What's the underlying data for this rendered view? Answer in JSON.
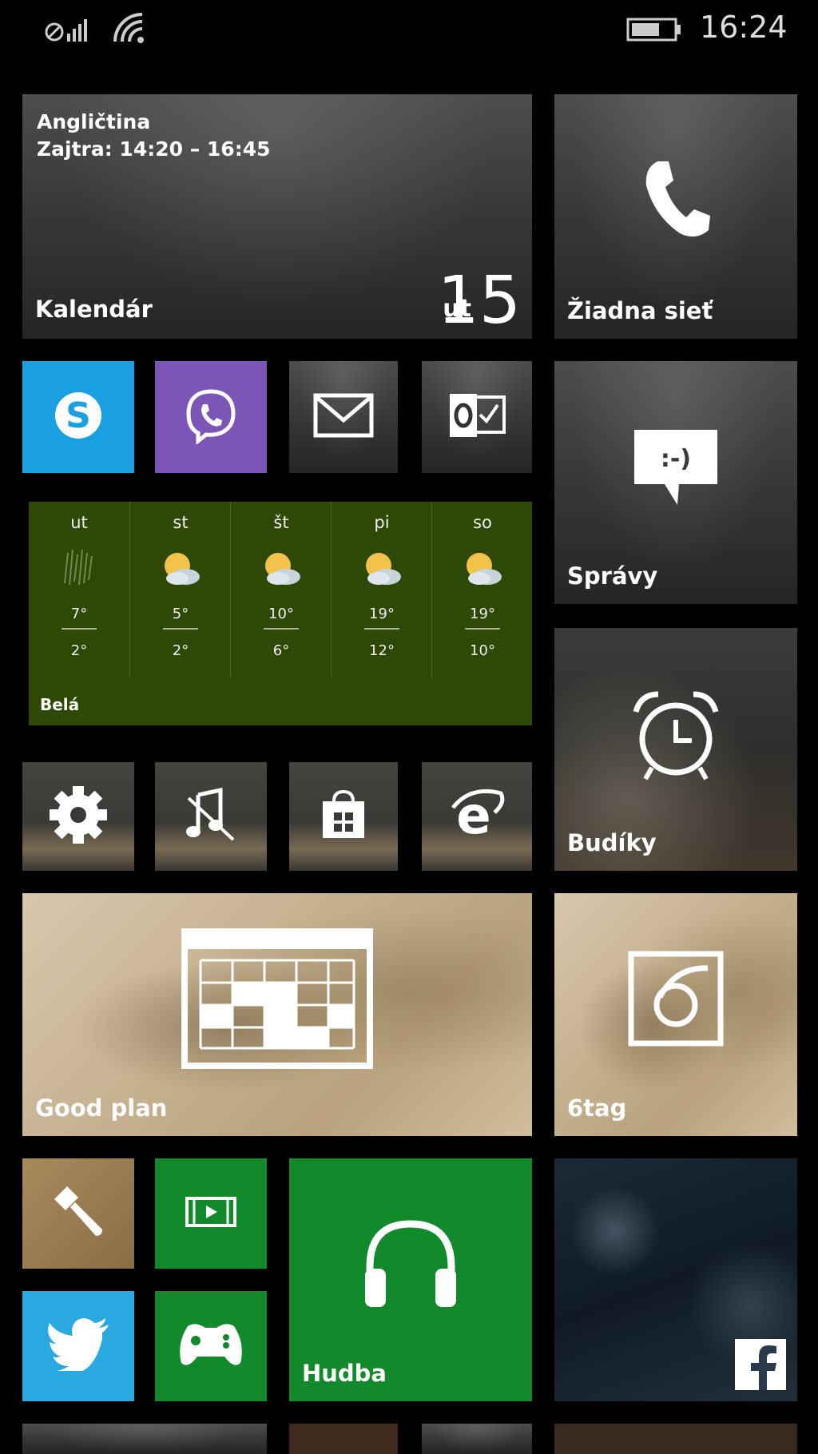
{
  "status_bar": {
    "time": "16:24"
  },
  "calendar_tile": {
    "event_title": "Angličtina",
    "event_time": "Zajtra: 14:20 – 16:45",
    "label": "Kalendár",
    "day_name": "ut",
    "day_number": "15"
  },
  "phone_tile": {
    "label": "Žiadna sieť",
    "icon": "phone-icon"
  },
  "messages_tile": {
    "label": "Správy",
    "icon": "message-icon"
  },
  "weather_tile": {
    "location": "Belá",
    "days": [
      {
        "day": "ut",
        "high": "7°",
        "low": "2°",
        "icon": "rain-icon"
      },
      {
        "day": "st",
        "high": "5°",
        "low": "2°",
        "icon": "partly-sunny-icon"
      },
      {
        "day": "št",
        "high": "10°",
        "low": "6°",
        "icon": "partly-sunny-icon"
      },
      {
        "day": "pi",
        "high": "19°",
        "low": "12°",
        "icon": "partly-sunny-icon"
      },
      {
        "day": "so",
        "high": "19°",
        "low": "10°",
        "icon": "partly-sunny-icon"
      }
    ]
  },
  "alarms_tile": {
    "label": "Budíky",
    "icon": "alarm-clock-icon"
  },
  "good_plan_tile": {
    "label": "Good plan",
    "icon": "calendar-grid-icon"
  },
  "sixtag_tile": {
    "label": "6tag",
    "icon": "6tag-icon"
  },
  "music_tile": {
    "label": "Hudba",
    "icon": "headphones-icon"
  },
  "facebook_tile": {
    "icon": "facebook-icon"
  },
  "colors": {
    "skype": "#1aa0e0",
    "viber": "#7b56b7",
    "green": "#128a2c",
    "twitter": "#2aa9e0",
    "weather": "#2e4805"
  }
}
